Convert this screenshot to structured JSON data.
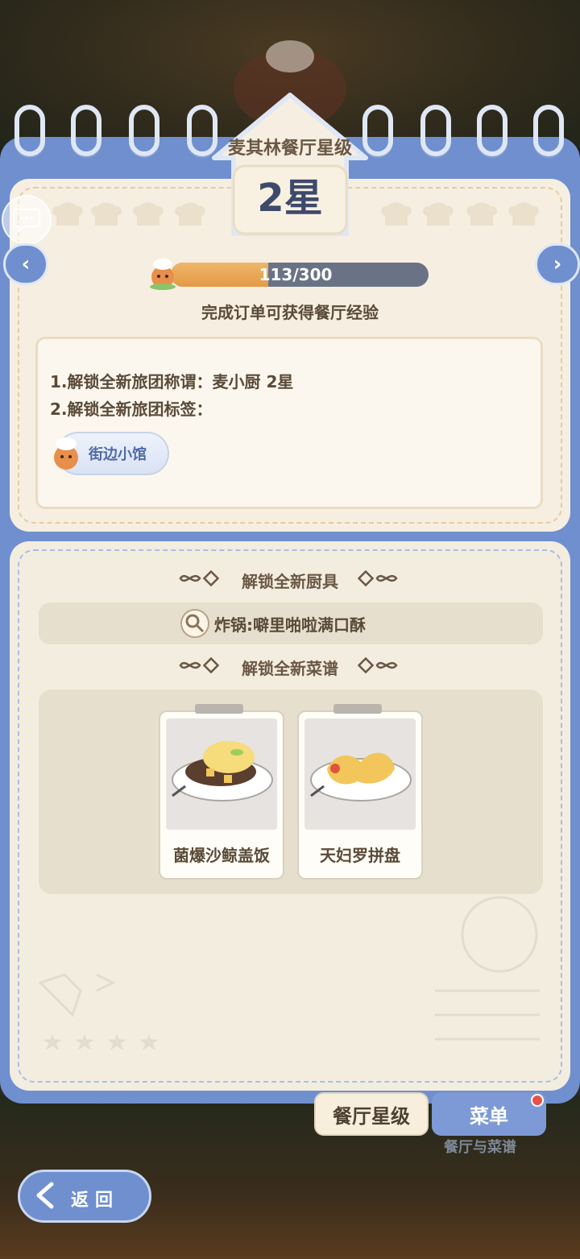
{
  "header": {
    "title": "麦其林餐厅星级",
    "level": "2星"
  },
  "progress": {
    "current": 113,
    "max": 300,
    "text": "113/300",
    "fraction": 0.377
  },
  "hint": "完成订单可获得餐厅经验",
  "rewards": {
    "line1": "1.解锁全新旅团称谓：麦小厨  2星",
    "line2": "2.解锁全新旅团标签：",
    "tag_label": "街边小馆"
  },
  "unlock_tools": {
    "heading": "解锁全新厨具",
    "item": "炸锅:噼里啪啦满口酥"
  },
  "unlock_recipes": {
    "heading": "解锁全新菜谱",
    "items": [
      {
        "name": "菌爆沙鲸盖饭"
      },
      {
        "name": "天妇罗拼盘"
      }
    ]
  },
  "tabs": {
    "rating": "餐厅星级",
    "menu": "菜单",
    "subtitle": "餐厅与菜谱"
  },
  "back": {
    "label": "返回"
  },
  "colors": {
    "accent": "#6f8fcf",
    "progress": "#e39a46",
    "paper": "#f6efe1",
    "text": "#5a4a38"
  },
  "icons": [
    "chat-icon",
    "arrow-left-icon",
    "arrow-right-icon",
    "chef-mascot-icon",
    "frying-pan-icon",
    "back-arrow-icon"
  ]
}
